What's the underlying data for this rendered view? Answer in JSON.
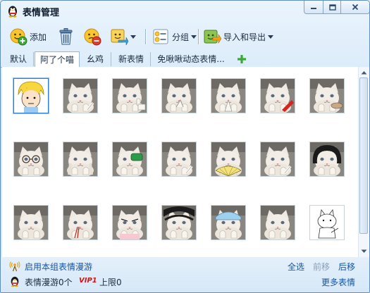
{
  "window": {
    "title": "表情管理"
  },
  "toolbar": {
    "add_label": "添加",
    "group_label": "分组",
    "import_export_label": "导入和导出"
  },
  "tabs": [
    {
      "label": "默认",
      "active": false
    },
    {
      "label": "阿了个喵",
      "active": true
    },
    {
      "label": "幺鸡",
      "active": false
    },
    {
      "label": "新表情",
      "active": false
    },
    {
      "label": "免啾啾动态表情...",
      "active": false
    }
  ],
  "grid": {
    "rows": 3,
    "columns": 7,
    "selected_index": 0,
    "items": [
      {
        "icon": "blonde-character-emoji-icon"
      },
      {
        "icon": "cat-pointing-emoji-icon"
      },
      {
        "icon": "cat-thumbs-up-emoji-icon"
      },
      {
        "icon": "cat-crossed-fingers-emoji-icon"
      },
      {
        "icon": "cat-praying-emoji-icon"
      },
      {
        "icon": "cat-red-object-emoji-icon"
      },
      {
        "icon": "cat-holding-object-emoji-icon"
      },
      {
        "icon": "cat-glasses-emoji-icon"
      },
      {
        "icon": "cat-hands-up-emoji-icon"
      },
      {
        "icon": "cat-green-object-emoji-icon"
      },
      {
        "icon": "cat-pointing-emoji-icon"
      },
      {
        "icon": "cat-fan-emoji-icon"
      },
      {
        "icon": "cat-pointing-emoji-icon"
      },
      {
        "icon": "cat-wig-emoji-icon"
      },
      {
        "icon": "cat-emoji-icon"
      },
      {
        "icon": "cat-chopsticks-emoji-icon"
      },
      {
        "icon": "cat-angry-emoji-icon"
      },
      {
        "icon": "cat-black-hair-emoji-icon"
      },
      {
        "icon": "cat-blue-hat-emoji-icon"
      },
      {
        "icon": "cat-emoji-icon"
      },
      {
        "icon": "cat-cartoon-emoji-icon"
      }
    ]
  },
  "footer": {
    "enable_roaming_label": "启用本组表情漫游",
    "select_all_label": "全选",
    "move_forward_label": "前移",
    "move_backward_label": "后移",
    "roaming_count_label": "表情漫游0个",
    "vip_badge": "VIP1",
    "limit_label": "上限0",
    "more_emoji_label": "更多表情"
  },
  "colors": {
    "link": "#1655a3",
    "disabled_link": "#8aa0b8",
    "selection_border": "#2d7fd6",
    "vip_red": "#d31414"
  }
}
